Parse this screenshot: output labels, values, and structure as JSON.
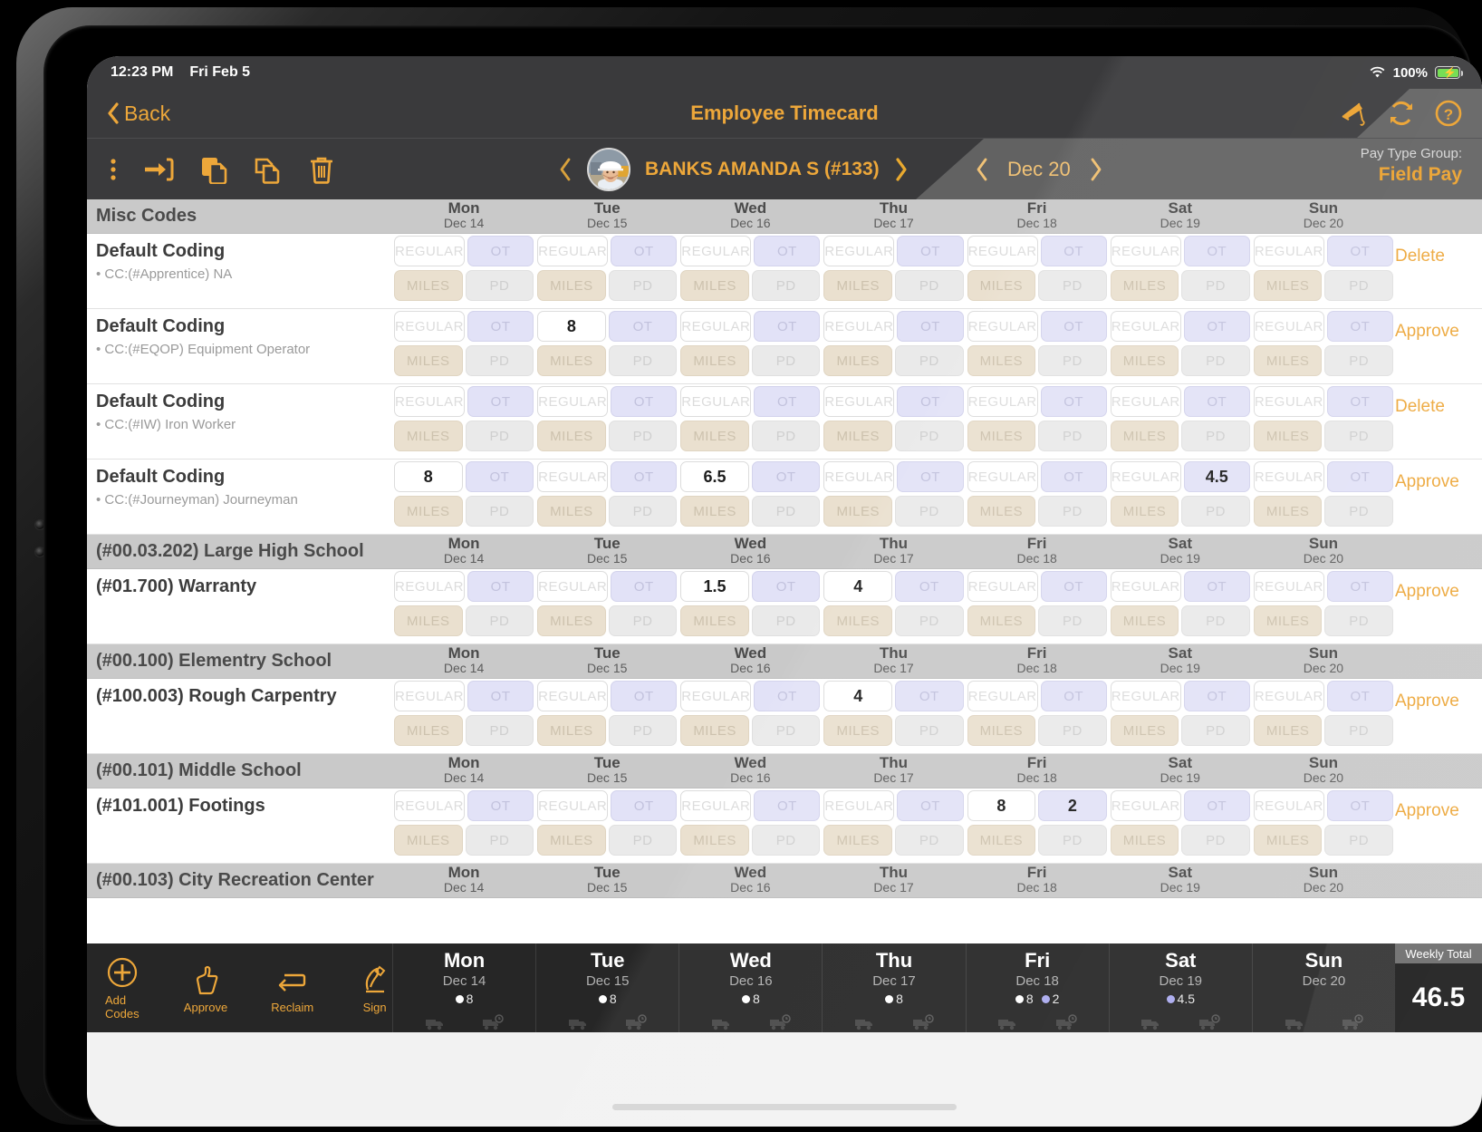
{
  "status_bar": {
    "time": "12:23 PM",
    "date": "Fri Feb 5",
    "battery": "100%",
    "wifi_icon": "wifi-icon",
    "battery_icon": "battery-charging-icon"
  },
  "nav": {
    "back_label": "Back",
    "title": "Employee Timecard",
    "icons": [
      "crane-icon",
      "refresh-icon",
      "help-icon"
    ]
  },
  "subheader": {
    "tool_icons": [
      "more-options-icon",
      "login-icon",
      "copy-file-icon",
      "duplicate-icon",
      "trash-icon"
    ],
    "employee": {
      "name": "BANKS AMANDA S (#133)",
      "avatar_icon": "employee-avatar",
      "prev_icon": "chevron-left-icon",
      "next_icon": "chevron-right-icon"
    },
    "date": {
      "value": "Dec 20",
      "prev_icon": "chevron-left-icon",
      "next_icon": "chevron-right-icon"
    },
    "pay_type_group": {
      "label": "Pay Type Group:",
      "value": "Field Pay"
    }
  },
  "day_columns": [
    {
      "dow": "Mon",
      "date": "Dec 14"
    },
    {
      "dow": "Tue",
      "date": "Dec 15"
    },
    {
      "dow": "Wed",
      "date": "Dec 16"
    },
    {
      "dow": "Thu",
      "date": "Dec 17"
    },
    {
      "dow": "Fri",
      "date": "Dec 18"
    },
    {
      "dow": "Sat",
      "date": "Dec 19"
    },
    {
      "dow": "Sun",
      "date": "Dec 20"
    }
  ],
  "cell_placeholders": {
    "regular": "REGULAR",
    "ot": "OT",
    "miles": "MILES",
    "pd": "PD"
  },
  "sections": [
    {
      "header": "Misc Codes",
      "rows": [
        {
          "title": "Default Coding",
          "subtitle": "• CC:(#Apprentice) NA",
          "action": "Delete",
          "values": {
            "regular": [
              "",
              "",
              "",
              "",
              "",
              "",
              ""
            ],
            "ot": [
              "",
              "",
              "",
              "",
              "",
              "",
              ""
            ],
            "miles": [
              "",
              "",
              "",
              "",
              "",
              "",
              ""
            ],
            "pd": [
              "",
              "",
              "",
              "",
              "",
              "",
              ""
            ]
          }
        },
        {
          "title": "Default Coding",
          "subtitle": "• CC:(#EQOP) Equipment Operator",
          "action": "Approve",
          "values": {
            "regular": [
              "",
              "8",
              "",
              "",
              "",
              "",
              ""
            ],
            "ot": [
              "",
              "",
              "",
              "",
              "",
              "",
              ""
            ],
            "miles": [
              "",
              "",
              "",
              "",
              "",
              "",
              ""
            ],
            "pd": [
              "",
              "",
              "",
              "",
              "",
              "",
              ""
            ]
          }
        },
        {
          "title": "Default Coding",
          "subtitle": "• CC:(#IW) Iron Worker",
          "action": "Delete",
          "values": {
            "regular": [
              "",
              "",
              "",
              "",
              "",
              "",
              ""
            ],
            "ot": [
              "",
              "",
              "",
              "",
              "",
              "",
              ""
            ],
            "miles": [
              "",
              "",
              "",
              "",
              "",
              "",
              ""
            ],
            "pd": [
              "",
              "",
              "",
              "",
              "",
              "",
              ""
            ]
          }
        },
        {
          "title": "Default Coding",
          "subtitle": "• CC:(#Journeyman) Journeyman",
          "action": "Approve",
          "values": {
            "regular": [
              "8",
              "",
              "6.5",
              "",
              "",
              "",
              ""
            ],
            "ot": [
              "",
              "",
              "",
              "",
              "",
              "4.5",
              ""
            ],
            "miles": [
              "",
              "",
              "",
              "",
              "",
              "",
              ""
            ],
            "pd": [
              "",
              "",
              "",
              "",
              "",
              "",
              ""
            ]
          }
        }
      ]
    },
    {
      "header": "(#00.03.202) Large High School",
      "rows": [
        {
          "title": "(#01.700) Warranty",
          "subtitle": "",
          "action": "Approve",
          "values": {
            "regular": [
              "",
              "",
              "1.5",
              "4",
              "",
              "",
              ""
            ],
            "ot": [
              "",
              "",
              "",
              "",
              "",
              "",
              ""
            ],
            "miles": [
              "",
              "",
              "",
              "",
              "",
              "",
              ""
            ],
            "pd": [
              "",
              "",
              "",
              "",
              "",
              "",
              ""
            ]
          }
        }
      ]
    },
    {
      "header": "(#00.100) Elementry School",
      "rows": [
        {
          "title": "(#100.003) Rough Carpentry",
          "subtitle": "",
          "action": "Approve",
          "values": {
            "regular": [
              "",
              "",
              "",
              "4",
              "",
              "",
              ""
            ],
            "ot": [
              "",
              "",
              "",
              "",
              "",
              "",
              ""
            ],
            "miles": [
              "",
              "",
              "",
              "",
              "",
              "",
              ""
            ],
            "pd": [
              "",
              "",
              "",
              "",
              "",
              "",
              ""
            ]
          }
        }
      ]
    },
    {
      "header": "(#00.101) Middle School",
      "rows": [
        {
          "title": "(#101.001) Footings",
          "subtitle": "",
          "action": "Approve",
          "values": {
            "regular": [
              "",
              "",
              "",
              "",
              "8",
              "",
              ""
            ],
            "ot": [
              "",
              "",
              "",
              "",
              "2",
              "",
              ""
            ],
            "miles": [
              "",
              "",
              "",
              "",
              "",
              "",
              ""
            ],
            "pd": [
              "",
              "",
              "",
              "",
              "",
              "",
              ""
            ]
          }
        }
      ]
    },
    {
      "header": "(#00.103) City Recreation Center",
      "rows": []
    }
  ],
  "footer": {
    "tools": [
      {
        "label": "Add Codes",
        "icon": "add-circle-icon"
      },
      {
        "label": "Approve",
        "icon": "thumbs-up-icon"
      },
      {
        "label": "Reclaim",
        "icon": "reclaim-arrow-icon"
      },
      {
        "label": "Sign",
        "icon": "signature-pen-icon"
      }
    ],
    "day_totals": [
      {
        "dow": "Mon",
        "date": "Dec 14",
        "entries": [
          {
            "type": "regular",
            "value": "8"
          }
        ]
      },
      {
        "dow": "Tue",
        "date": "Dec 15",
        "entries": [
          {
            "type": "regular",
            "value": "8"
          }
        ]
      },
      {
        "dow": "Wed",
        "date": "Dec 16",
        "entries": [
          {
            "type": "regular",
            "value": "8"
          }
        ]
      },
      {
        "dow": "Thu",
        "date": "Dec 17",
        "entries": [
          {
            "type": "regular",
            "value": "8"
          }
        ]
      },
      {
        "dow": "Fri",
        "date": "Dec 18",
        "entries": [
          {
            "type": "regular",
            "value": "8"
          },
          {
            "type": "ot",
            "value": "2"
          }
        ]
      },
      {
        "dow": "Sat",
        "date": "Dec 19",
        "entries": [
          {
            "type": "ot",
            "value": "4.5"
          }
        ]
      },
      {
        "dow": "Sun",
        "date": "Dec 20",
        "entries": []
      }
    ],
    "weekly_total": {
      "label": "Weekly Total",
      "value": "46.5"
    }
  },
  "colors": {
    "accent": "#eda73a",
    "header_bar": "#3a3a3c",
    "section_header": "#c9c9c9",
    "ot_cell": "#e2e2f7",
    "miles_cell": "#eae0cf",
    "pd_cell": "#eaeaea",
    "footer_bg": "#262626"
  }
}
